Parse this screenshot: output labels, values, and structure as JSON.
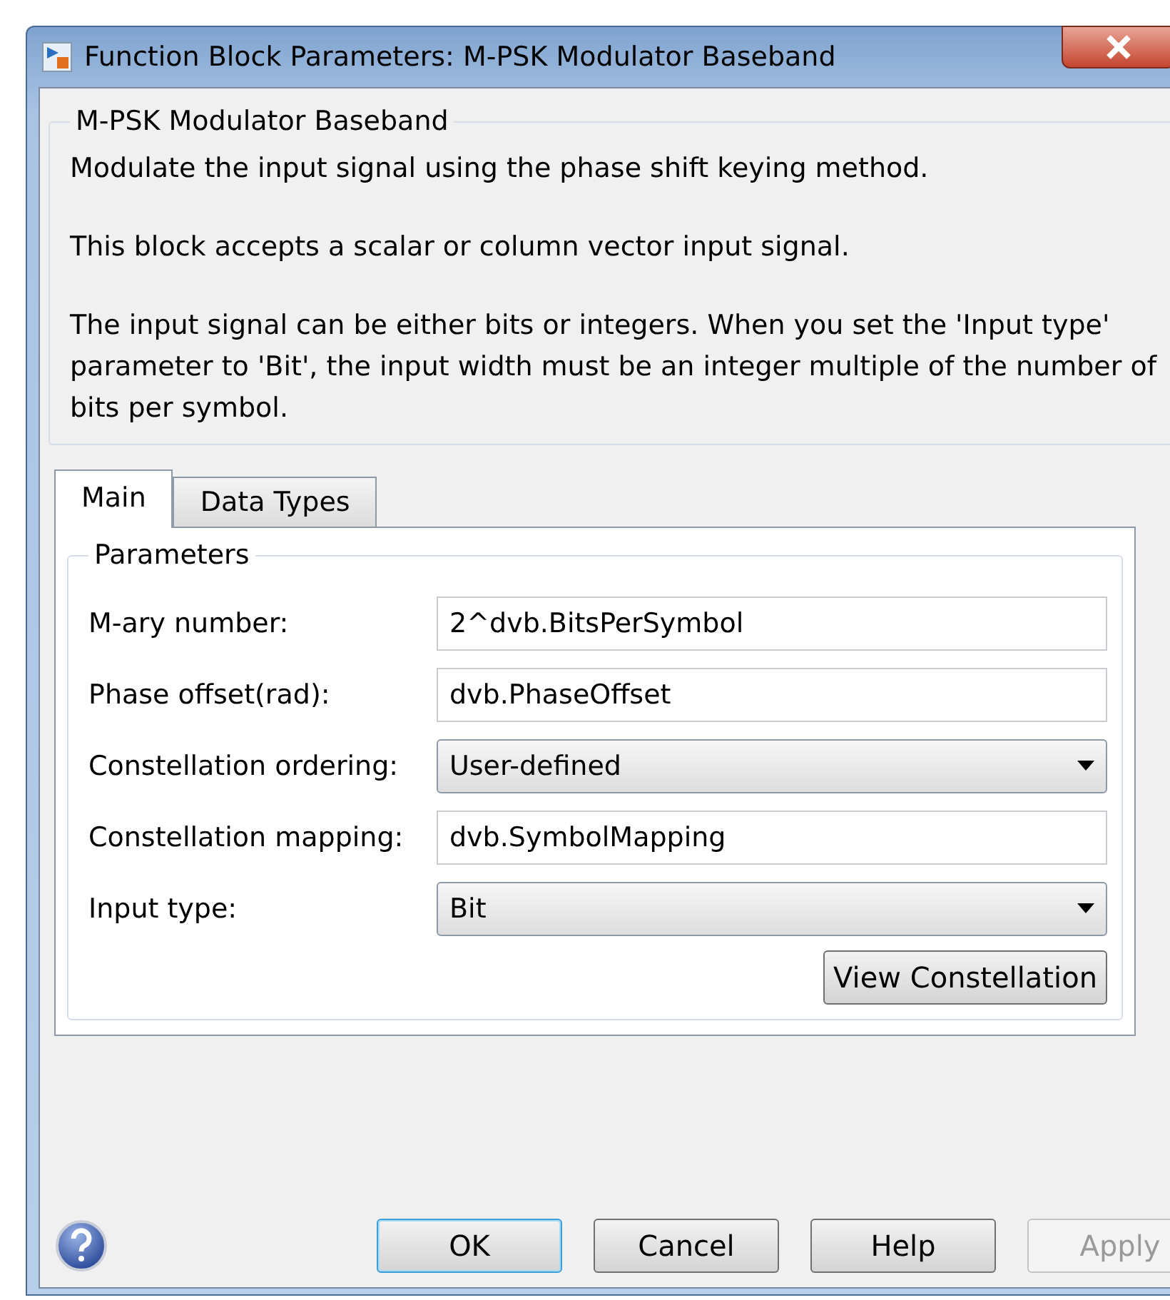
{
  "window": {
    "title": "Function Block Parameters: M-PSK Modulator Baseband"
  },
  "description": {
    "title": "M-PSK Modulator Baseband",
    "paragraphs": [
      "Modulate the input signal using the phase shift keying method.",
      "This block accepts a scalar or column vector input signal.",
      "The input signal can be either bits or integers. When you set the 'Input type' parameter to 'Bit', the input width must be an integer multiple of the number of bits per symbol."
    ]
  },
  "tabs": [
    {
      "label": "Main",
      "selected": true
    },
    {
      "label": "Data Types",
      "selected": false
    }
  ],
  "parameters": {
    "title": "Parameters",
    "fields": [
      {
        "kind": "text",
        "label": "M-ary number:",
        "value": "2^dvb.BitsPerSymbol"
      },
      {
        "kind": "text",
        "label": "Phase offset(rad):",
        "value": "dvb.PhaseOffset"
      },
      {
        "kind": "dropdown",
        "label": "Constellation ordering:",
        "value": "User-defined"
      },
      {
        "kind": "text",
        "label": "Constellation mapping:",
        "value": "dvb.SymbolMapping"
      },
      {
        "kind": "dropdown",
        "label": "Input type:",
        "value": "Bit"
      }
    ],
    "action": "View Constellation"
  },
  "buttons": [
    {
      "label": "OK",
      "default": true,
      "disabled": false
    },
    {
      "label": "Cancel",
      "default": false,
      "disabled": false
    },
    {
      "label": "Help",
      "default": false,
      "disabled": false
    },
    {
      "label": "Apply",
      "default": false,
      "disabled": true
    }
  ]
}
